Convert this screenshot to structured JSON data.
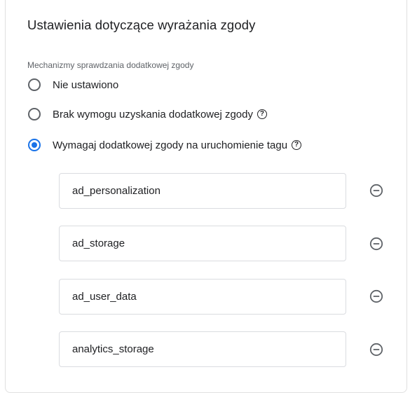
{
  "panel": {
    "title": "Ustawienia dotyczące wyrażania zgody",
    "section_label": "Mechanizmy sprawdzania dodatkowej zgody",
    "options": [
      {
        "label": "Nie ustawiono",
        "checked": false,
        "help": false
      },
      {
        "label": "Brak wymogu uzyskania dodatkowej zgody",
        "checked": false,
        "help": true
      },
      {
        "label": "Wymagaj dodatkowej zgody na uruchomienie tagu",
        "checked": true,
        "help": true
      }
    ],
    "consent_types": [
      {
        "value": "ad_personalization"
      },
      {
        "value": "ad_storage"
      },
      {
        "value": "ad_user_data"
      },
      {
        "value": "analytics_storage"
      }
    ],
    "help_glyph": "?",
    "icons": {
      "help": "help-circle-icon",
      "remove": "remove-circle-icon"
    },
    "colors": {
      "accent": "#1a73e8",
      "text": "#202124",
      "muted": "#5f6368",
      "border": "#dadce0"
    }
  }
}
